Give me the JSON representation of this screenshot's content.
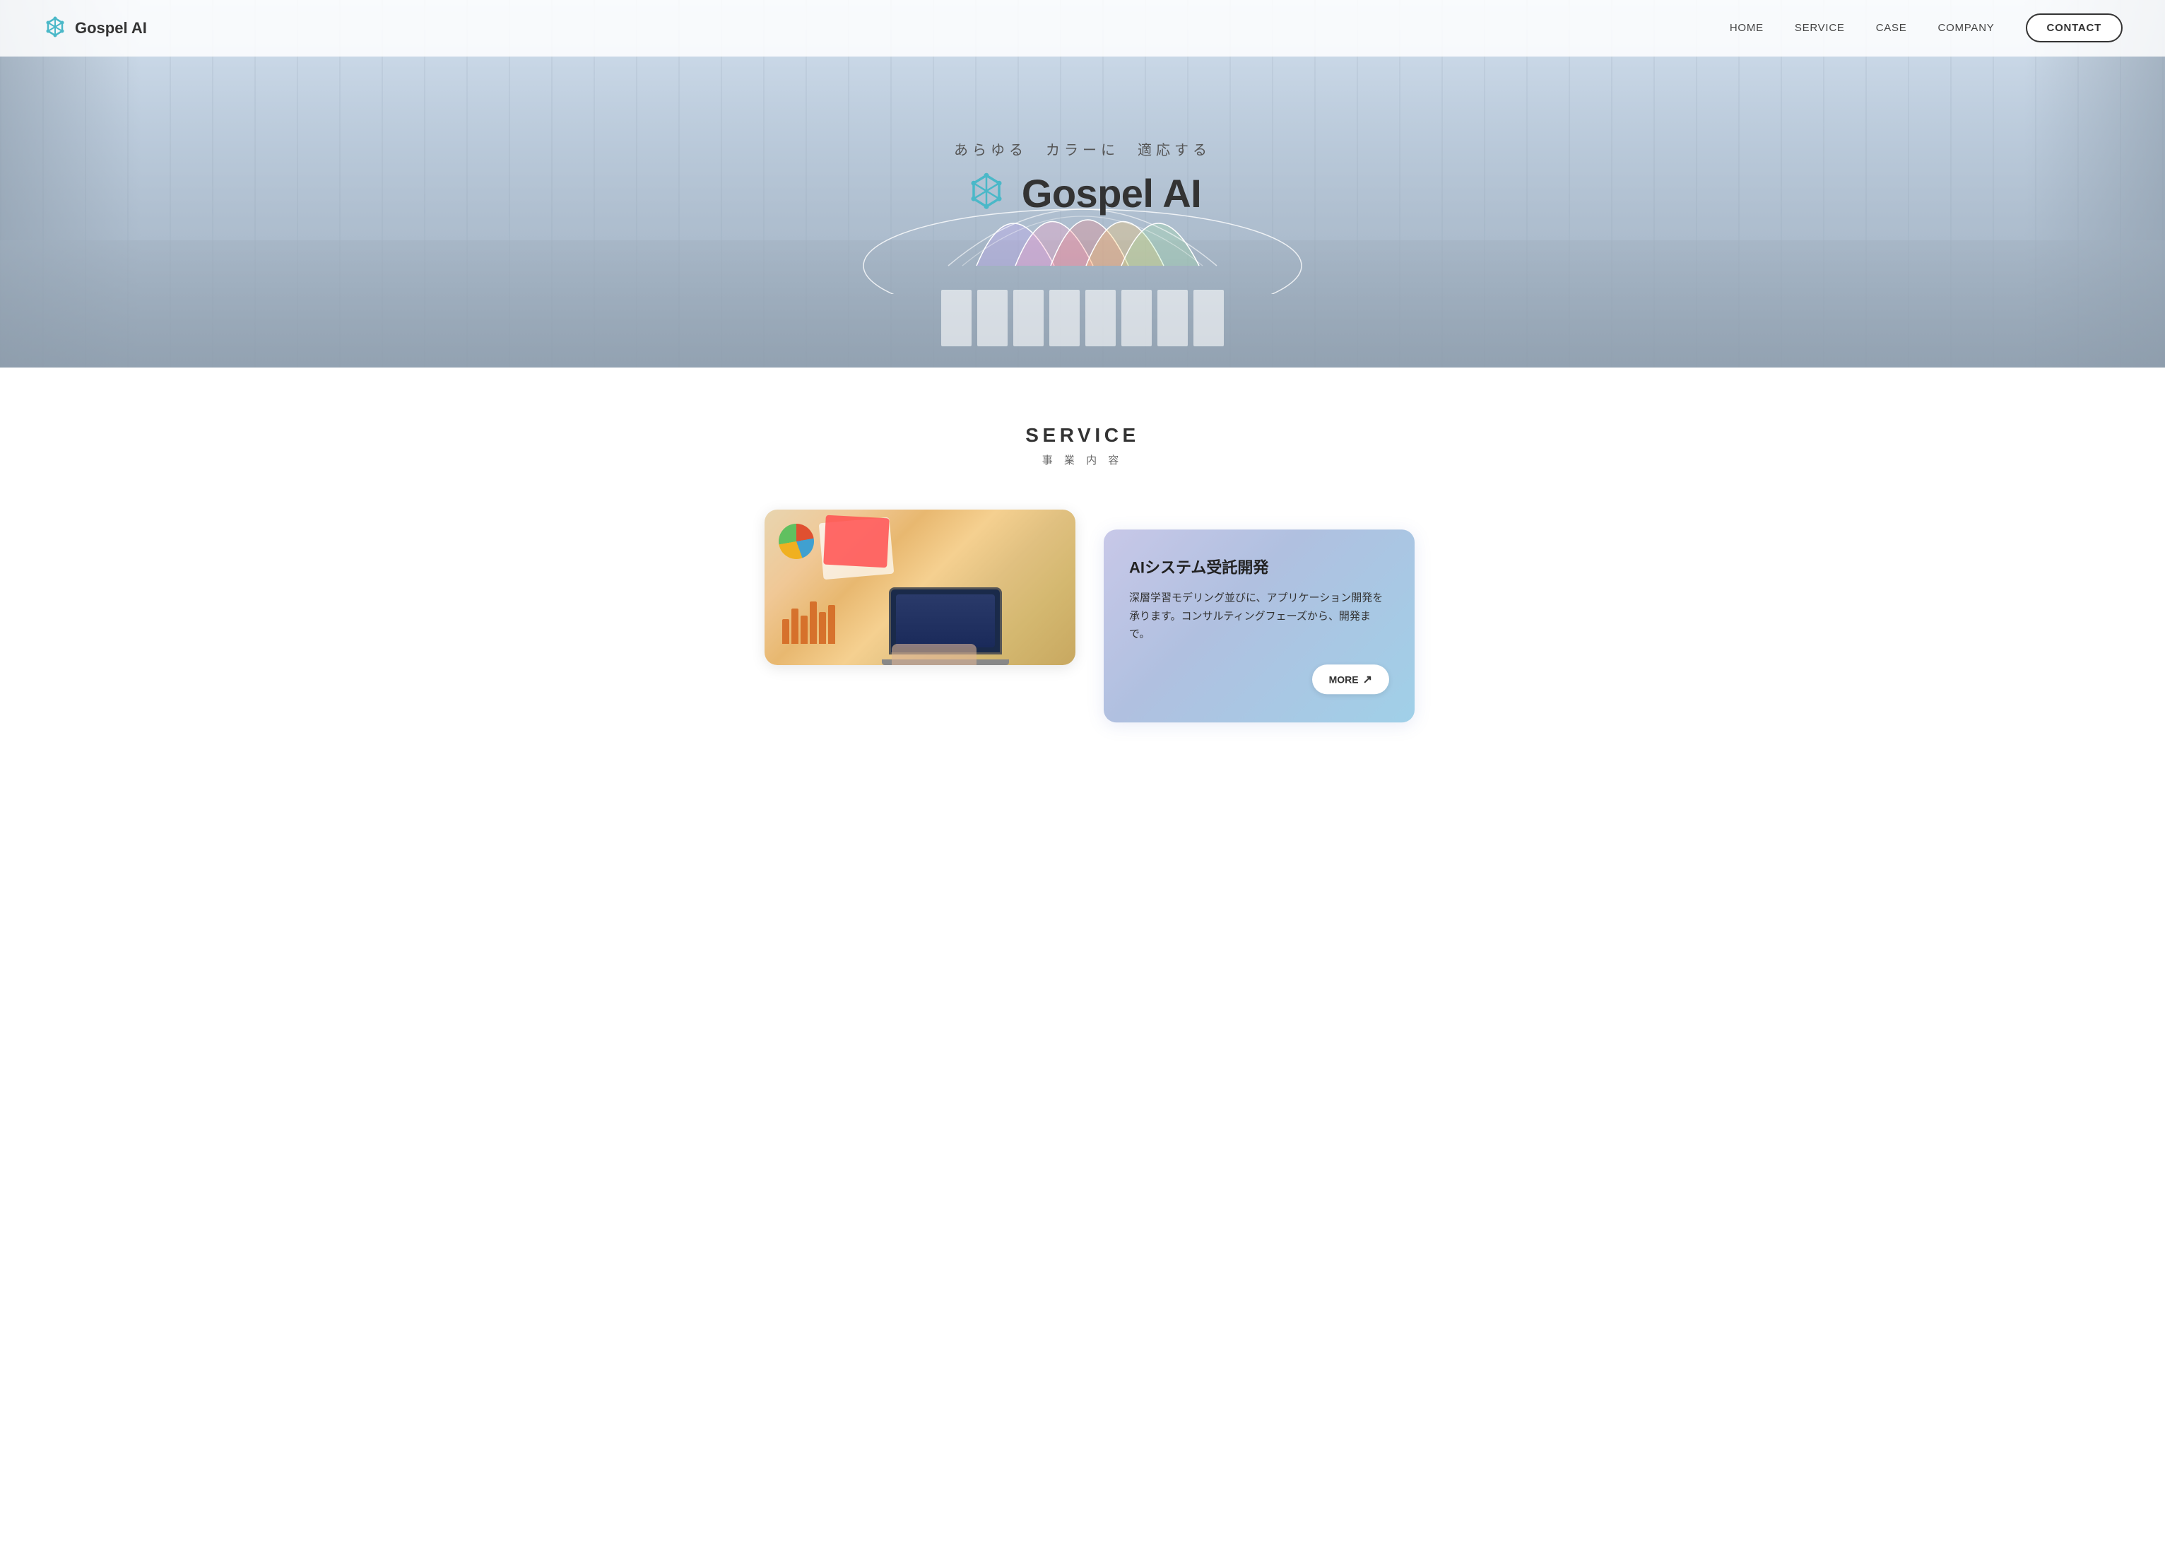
{
  "nav": {
    "logo_text": "Gospel AI",
    "links": [
      {
        "label": "HOME",
        "id": "home"
      },
      {
        "label": "SERVICE",
        "id": "service"
      },
      {
        "label": "CASE",
        "id": "case"
      },
      {
        "label": "COMPANY",
        "id": "company"
      },
      {
        "label": "CONTACT",
        "id": "contact",
        "is_button": true
      }
    ]
  },
  "hero": {
    "tagline": "あらゆる　カラーに　適応する",
    "brand_text": "Gospel AI"
  },
  "service": {
    "title": "SERVICE",
    "subtitle": "事 業 内 容",
    "card": {
      "title": "AIシステム受託開発",
      "description": "深層学習モデリング並びに、アプリケーション開発を承ります。コンサルティングフェーズから、開発まで。",
      "more_label": "MORE",
      "more_arrow": "↗"
    }
  }
}
